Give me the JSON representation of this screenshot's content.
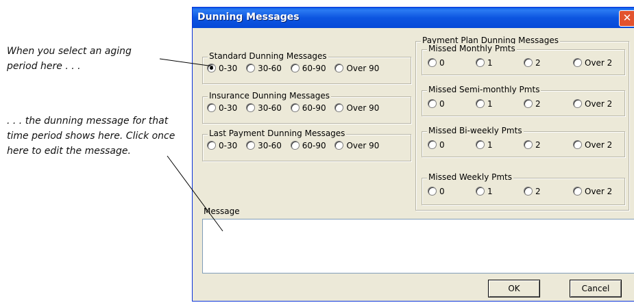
{
  "annotations": {
    "first": "When you select an aging period here . . .",
    "second": ". . . the dunning message for that time period shows here. Click once here to edit the message."
  },
  "dialog": {
    "title": "Dunning Messages",
    "close_label": "✕"
  },
  "standard": {
    "label": "Standard Dunning Messages",
    "options": [
      "0-30",
      "30-60",
      "60-90",
      "Over 90"
    ],
    "selected": "0-30"
  },
  "insurance": {
    "label": "Insurance Dunning Messages",
    "options": [
      "0-30",
      "30-60",
      "60-90",
      "Over 90"
    ]
  },
  "last_payment": {
    "label": "Last Payment Dunning Messages",
    "options": [
      "0-30",
      "30-60",
      "60-90",
      "Over 90"
    ]
  },
  "payment_plan": {
    "label": "Payment Plan Dunning Messages",
    "groups": [
      {
        "label": "Missed Monthly Pmts",
        "options": [
          "0",
          "1",
          "2",
          "Over 2"
        ]
      },
      {
        "label": "Missed Semi-monthly Pmts",
        "options": [
          "0",
          "1",
          "2",
          "Over 2"
        ]
      },
      {
        "label": "Missed Bi-weekly Pmts",
        "options": [
          "0",
          "1",
          "2",
          "Over 2"
        ]
      },
      {
        "label": "Missed Weekly Pmts",
        "options": [
          "0",
          "1",
          "2",
          "Over 2"
        ]
      }
    ]
  },
  "message": {
    "label": "Message",
    "value": ""
  },
  "buttons": {
    "ok": "OK",
    "cancel": "Cancel"
  }
}
